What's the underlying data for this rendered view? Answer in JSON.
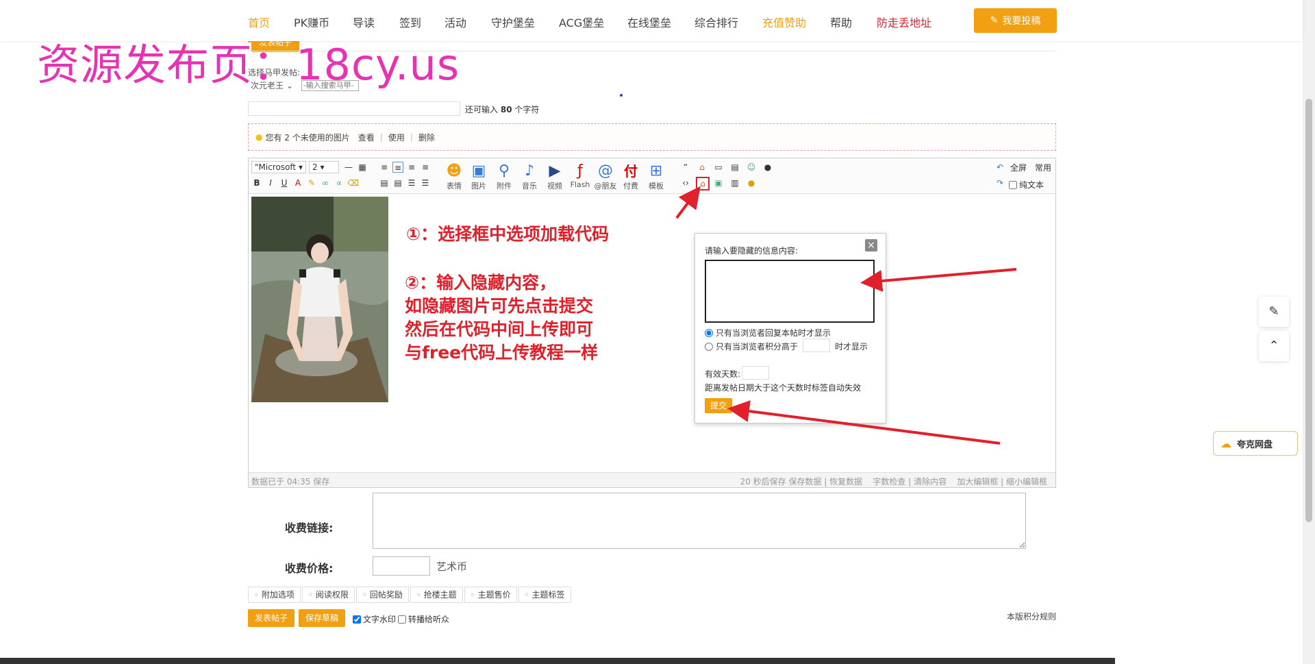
{
  "nav": {
    "items": [
      "首页",
      "PK赚币",
      "导读",
      "签到",
      "活动",
      "守护堡垒",
      "ACG堡垒",
      "在线堡垒",
      "综合排行",
      "充值赞助",
      "帮助",
      "防走丢地址"
    ],
    "submit_label": "我要投稿"
  },
  "watermark": "资源发布页：18cy.us",
  "post_form": {
    "top_button": "发表帖子",
    "select_label": "选择马甲发帖:",
    "alias_value": "次元老王",
    "alias_search_placeholder": "-输入搜索马甲-",
    "title_remaining_prefix": "还可输入",
    "title_remaining_count": "80",
    "title_remaining_suffix": "个字符"
  },
  "image_hint": {
    "text": "您有 2 个未使用的图片",
    "view": "查看",
    "use": "使用",
    "delete": "删除"
  },
  "editor": {
    "font": "\"Microsoft",
    "size": "2",
    "big_buttons": [
      "表情",
      "图片",
      "附件",
      "音乐",
      "视频",
      "Flash",
      "@朋友",
      "付费",
      "模板"
    ],
    "fullscreen": "全屏",
    "common": "常用",
    "plain_text": "纯文本",
    "status_left": "数据已于 04:35 保存",
    "status_right": "20 秒后保存 保存数据 | 恢复数据    字数检查 | 清除内容    加大编辑框 | 缩小编辑框"
  },
  "annotations": {
    "step1": "①：选择框中选项加载代码",
    "step2_lines": [
      "②：输入隐藏内容，",
      "如隐藏图片可先点击提交",
      "然后在代码中间上传即可",
      "与free代码上传教程一样"
    ]
  },
  "hide_popup": {
    "prompt": "请输入要隐藏的信息内容:",
    "option_reply": "只有当浏览者回复本帖时才显示",
    "option_score_prefix": "只有当浏览者积分高于",
    "option_score_suffix": "时才显示",
    "days_label": "有效天数:",
    "days_note": "距离发帖日期大于这个天数时标签自动失效",
    "submit": "提交"
  },
  "paid": {
    "link_label": "收费链接:",
    "price_label": "收费价格:",
    "currency": "艺术币"
  },
  "option_tabs": [
    "附加选项",
    "阅读权限",
    "回帖奖励",
    "抢楼主题",
    "主题售价",
    "主题标签"
  ],
  "actions": {
    "post": "发表帖子",
    "draft": "保存草稿",
    "watermark_text": "文字水印",
    "broadcast": "转播给听众",
    "rules": "本版积分规则"
  },
  "side": {
    "quark": "夸克网盘"
  },
  "colors": {
    "accent": "#f0a010",
    "annotation": "#e0202a",
    "watermark": "#e832b4"
  }
}
